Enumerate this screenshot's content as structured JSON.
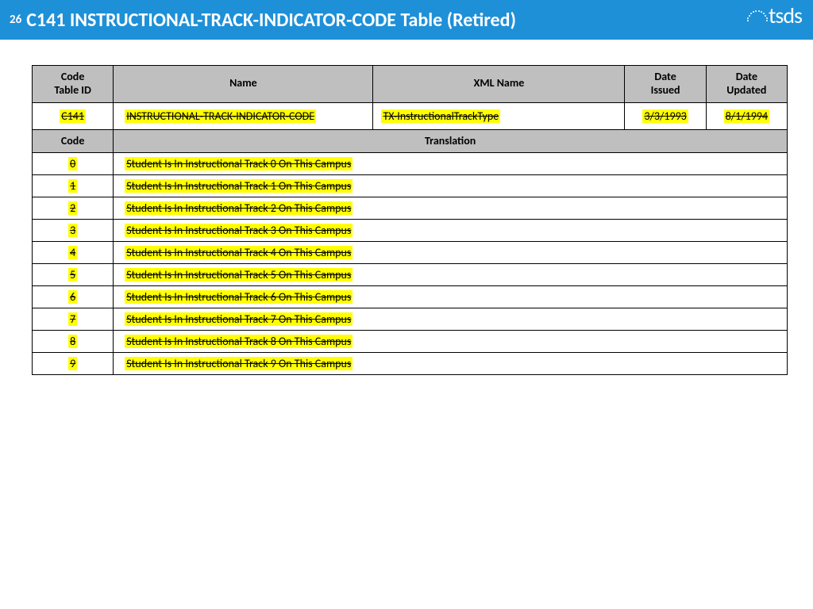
{
  "header": {
    "slide_number": "26",
    "title": "C141 INSTRUCTIONAL-TRACK-INDICATOR-CODE Table (Retired)",
    "logo_text": "tsds"
  },
  "table1": {
    "headers": {
      "code_table_id": "Code\nTable ID",
      "name": "Name",
      "xml_name": "XML Name",
      "date_issued": "Date\nIssued",
      "date_updated": "Date\nUpdated"
    },
    "row": {
      "code_table_id": "C141",
      "name": "INSTRUCTIONAL-TRACK-INDICATOR-CODE",
      "xml_name": "TX-InstructionalTrackType",
      "date_issued": "3/3/1993",
      "date_updated": "8/1/1994"
    }
  },
  "table2": {
    "headers": {
      "code": "Code",
      "translation": "Translation"
    },
    "rows": [
      {
        "code": "0",
        "translation": "Student Is In Instructional Track 0 On This Campus"
      },
      {
        "code": "1",
        "translation": "Student Is In Instructional Track 1 On This Campus"
      },
      {
        "code": "2",
        "translation": "Student Is In Instructional Track 2 On This Campus"
      },
      {
        "code": "3",
        "translation": "Student Is In Instructional Track 3 On This Campus"
      },
      {
        "code": "4",
        "translation": "Student Is In Instructional Track 4 On This Campus"
      },
      {
        "code": "5",
        "translation": "Student Is In Instructional Track 5 On This Campus"
      },
      {
        "code": "6",
        "translation": "Student Is In Instructional Track 6 On This Campus"
      },
      {
        "code": "7",
        "translation": "Student Is In Instructional Track 7 On This Campus"
      },
      {
        "code": "8",
        "translation": "Student Is In Instructional Track 8 On This Campus"
      },
      {
        "code": "9",
        "translation": "Student Is In Instructional Track 9 On This Campus"
      }
    ]
  }
}
